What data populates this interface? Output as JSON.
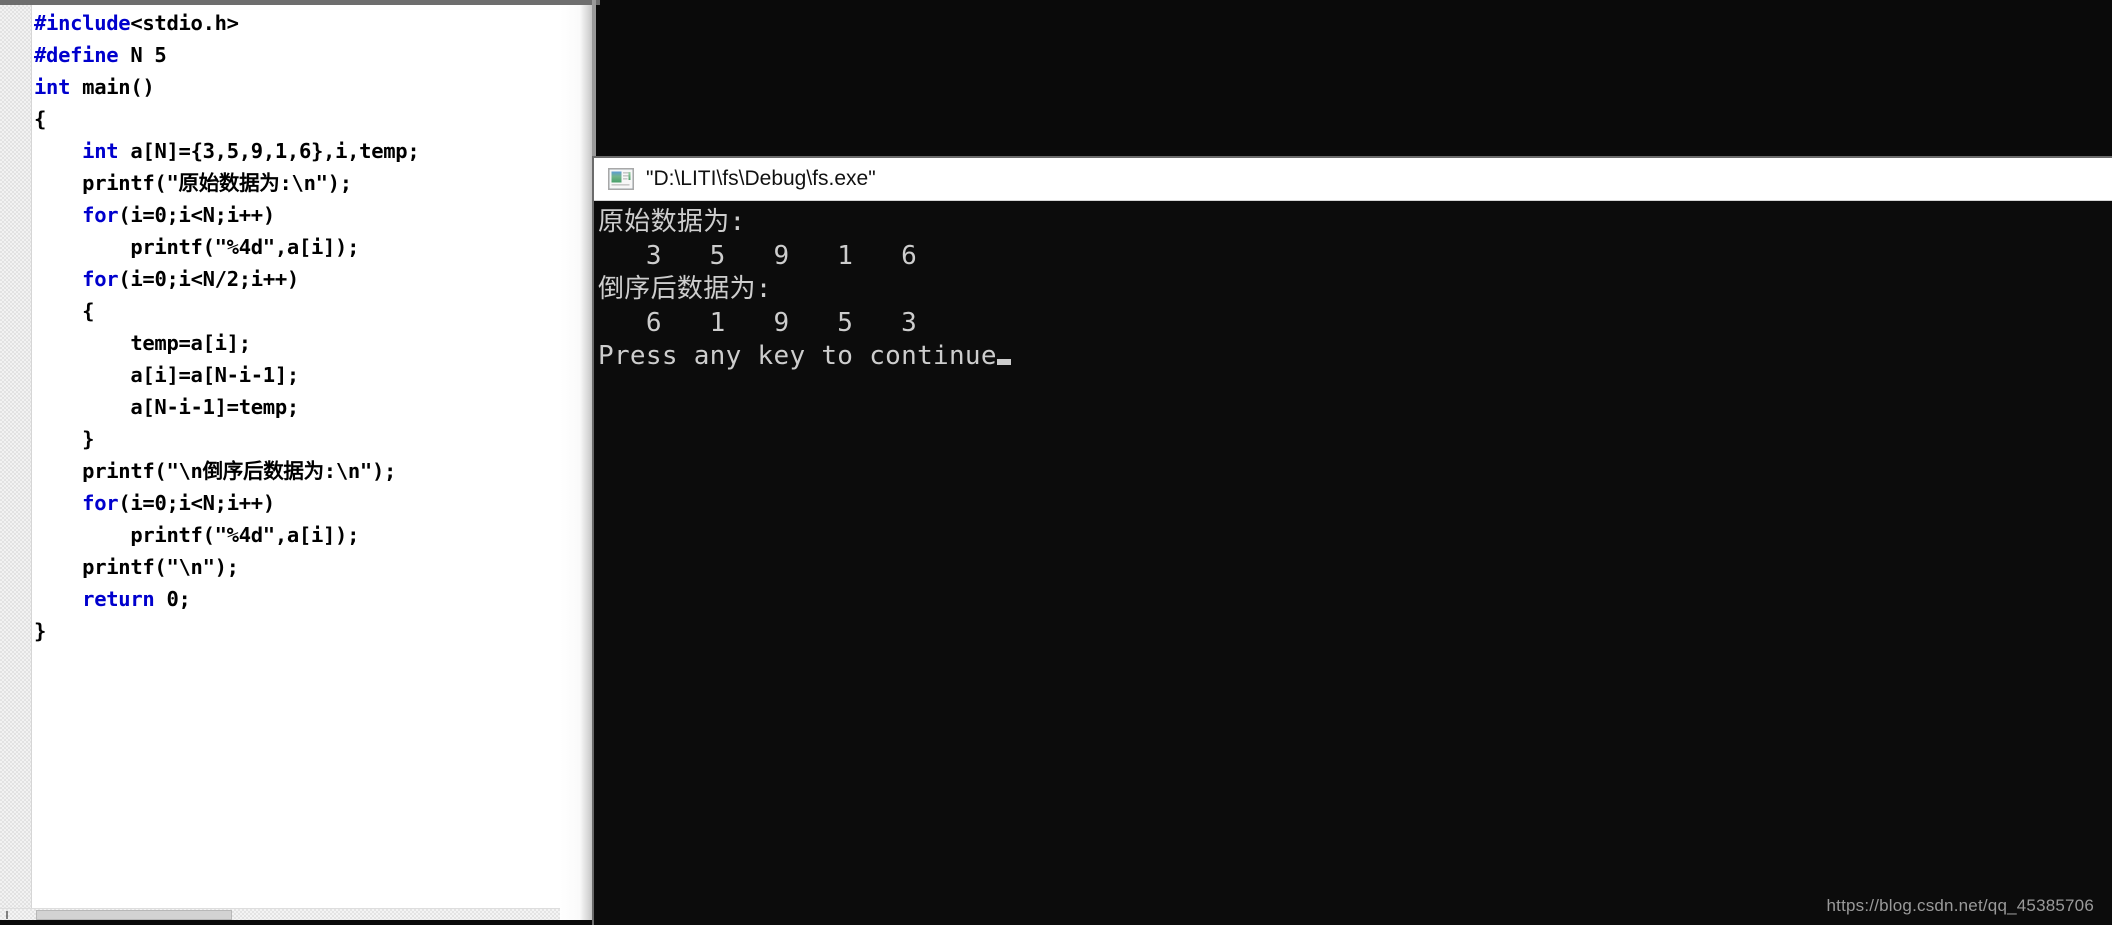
{
  "editor": {
    "name": "source-code-editor",
    "language": "c",
    "lines": [
      {
        "indent": 0,
        "segments": [
          {
            "t": "#include",
            "c": "pp"
          },
          {
            "t": "<stdio.h>",
            "c": ""
          }
        ]
      },
      {
        "indent": 0,
        "segments": [
          {
            "t": "#define",
            "c": "pp"
          },
          {
            "t": " N 5",
            "c": ""
          }
        ]
      },
      {
        "indent": 0,
        "segments": [
          {
            "t": "int",
            "c": "kw"
          },
          {
            "t": " main()",
            "c": ""
          }
        ]
      },
      {
        "indent": 0,
        "segments": [
          {
            "t": "{",
            "c": ""
          }
        ]
      },
      {
        "indent": 4,
        "segments": [
          {
            "t": "int",
            "c": "kw"
          },
          {
            "t": " a[N]={3,5,9,1,6},i,temp;",
            "c": ""
          }
        ]
      },
      {
        "indent": 4,
        "segments": [
          {
            "t": "printf(\"原始数据为:\\n\");",
            "c": ""
          }
        ]
      },
      {
        "indent": 4,
        "segments": [
          {
            "t": "for",
            "c": "kw"
          },
          {
            "t": "(i=0;i<N;i++)",
            "c": ""
          }
        ]
      },
      {
        "indent": 8,
        "segments": [
          {
            "t": "printf(\"%4d\",a[i]);",
            "c": ""
          }
        ]
      },
      {
        "indent": 4,
        "segments": [
          {
            "t": "for",
            "c": "kw"
          },
          {
            "t": "(i=0;i<N/2;i++)",
            "c": ""
          }
        ]
      },
      {
        "indent": 4,
        "segments": [
          {
            "t": "{",
            "c": ""
          }
        ]
      },
      {
        "indent": 8,
        "segments": [
          {
            "t": "temp=a[i];",
            "c": ""
          }
        ]
      },
      {
        "indent": 8,
        "segments": [
          {
            "t": "a[i]=a[N-i-1];",
            "c": ""
          }
        ]
      },
      {
        "indent": 8,
        "segments": [
          {
            "t": "a[N-i-1]=temp;",
            "c": ""
          }
        ]
      },
      {
        "indent": 4,
        "segments": [
          {
            "t": "}",
            "c": ""
          }
        ]
      },
      {
        "indent": 4,
        "segments": [
          {
            "t": "printf(\"\\n倒序后数据为:\\n\");",
            "c": ""
          }
        ]
      },
      {
        "indent": 4,
        "segments": [
          {
            "t": "for",
            "c": "kw"
          },
          {
            "t": "(i=0;i<N;i++)",
            "c": ""
          }
        ]
      },
      {
        "indent": 8,
        "segments": [
          {
            "t": "printf(\"%4d\",a[i]);",
            "c": ""
          }
        ]
      },
      {
        "indent": 4,
        "segments": [
          {
            "t": "printf(\"\\n\");",
            "c": ""
          }
        ]
      },
      {
        "indent": 4,
        "segments": [
          {
            "t": "return",
            "c": "kw"
          },
          {
            "t": " 0;",
            "c": ""
          }
        ]
      },
      {
        "indent": 0,
        "segments": [
          {
            "t": "}",
            "c": ""
          }
        ]
      }
    ],
    "keyword_color": "#0000cd",
    "text_color": "#000000",
    "background_color": "#ffffff"
  },
  "console": {
    "title": "\"D:\\LITI\\fs\\Debug\\fs.exe\"",
    "icon": "console-window-icon",
    "background_color": "#0c0c0c",
    "text_color": "#cdcdcd",
    "output_lines": [
      "原始数据为:",
      "   3   5   9   1   6",
      "倒序后数据为:",
      "   6   1   9   5   3",
      "Press any key to continue"
    ],
    "cursor_visible": true
  },
  "program_data": {
    "array_name": "a",
    "array_size": 5,
    "original": [
      3,
      5,
      9,
      1,
      6
    ],
    "reversed": [
      6,
      1,
      9,
      5,
      3
    ],
    "original_label": "原始数据为:",
    "reversed_label": "倒序后数据为:",
    "prompt": "Press any key to continue"
  },
  "watermark": {
    "text": "https://blog.csdn.net/qq_45385706"
  },
  "scrollbar": {
    "orientation": "horizontal",
    "thumb_position_pct": 6
  }
}
